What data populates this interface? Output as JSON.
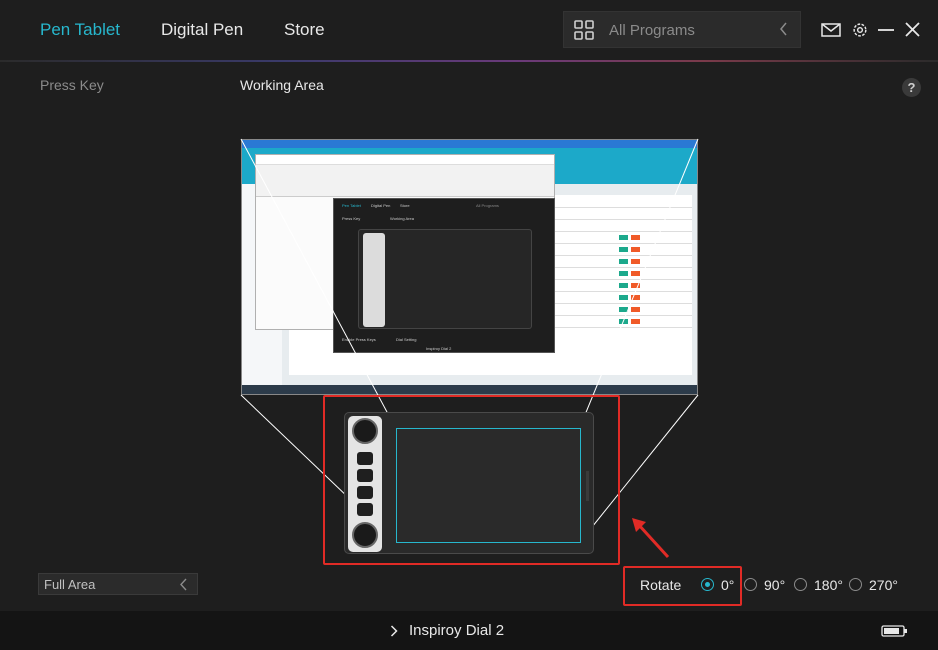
{
  "nav": {
    "tabs": [
      {
        "label": "Pen Tablet",
        "active": true
      },
      {
        "label": "Digital Pen",
        "active": false
      },
      {
        "label": "Store",
        "active": false
      }
    ],
    "program_select": {
      "label": "All Programs"
    }
  },
  "section": {
    "left_title": "Press Key",
    "right_title": "Working Area",
    "help": "?"
  },
  "preview": {
    "mini_app": {
      "tabs": [
        "Pen Tablet",
        "Digital Pen",
        "Store"
      ],
      "programs": "All Programs",
      "press_key": "Press Key",
      "working_area": "Working Area",
      "enable_press_keys": "Enable Press Keys",
      "dial_setting": "Dial Setting",
      "device": "Inspiroy Dial 2"
    }
  },
  "area": {
    "selected": "Full Area"
  },
  "rotate": {
    "label": "Rotate",
    "options": [
      "0°",
      "90°",
      "180°",
      "270°"
    ],
    "selected": "0°"
  },
  "footer": {
    "device_name": "Inspiroy Dial 2"
  },
  "colors": {
    "accent": "#27b7cd",
    "highlight": "#e12b26",
    "background": "#1e1e1e"
  },
  "icons": [
    "grid-icon",
    "chevron-left-icon",
    "mail-icon",
    "gear-icon",
    "minimize-icon",
    "close-icon",
    "help-icon",
    "chevron-right-icon",
    "battery-icon"
  ]
}
